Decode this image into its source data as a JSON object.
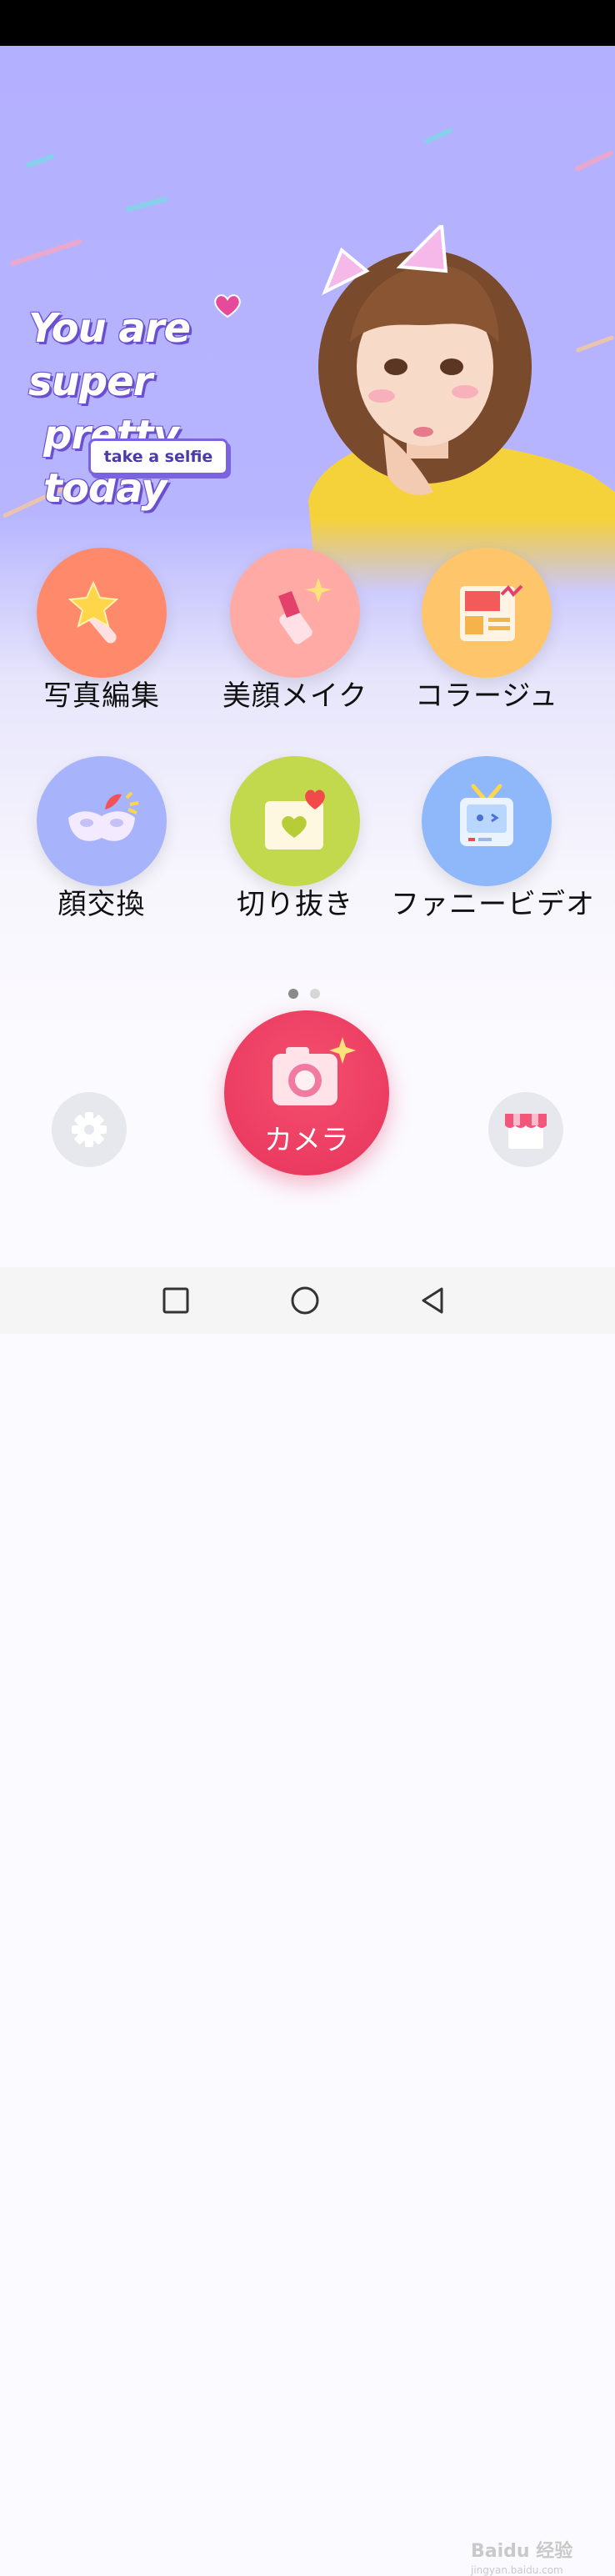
{
  "banner": {
    "tagline_line1": "You are super",
    "tagline_line2": "pretty today",
    "selfie_button": "take a selfie",
    "colors": {
      "background": "#b3b0ff",
      "accent": "#6a4fd0"
    }
  },
  "features": [
    {
      "label": "写真編集",
      "icon": "magic-wand-icon",
      "color": "#ff8a6b"
    },
    {
      "label": "美顔メイク",
      "icon": "lipstick-icon",
      "color": "#ffaaa4"
    },
    {
      "label": "コラージュ",
      "icon": "collage-icon",
      "color": "#ffc56a"
    },
    {
      "label": "顔交換",
      "icon": "mask-icon",
      "color": "#a7b3fb"
    },
    {
      "label": "切り抜き",
      "icon": "heart-card-icon",
      "color": "#c2d94d"
    },
    {
      "label": "ファニービデオ",
      "icon": "tv-icon",
      "color": "#8fb8fb"
    }
  ],
  "pagination": {
    "current": 1,
    "total": 2
  },
  "camera": {
    "label": "カメラ",
    "color": "#ee3f64"
  },
  "actions": {
    "settings_icon": "gear-icon",
    "shop_icon": "store-icon"
  },
  "watermark": {
    "brand": "Baidu 经验",
    "url": "jingyan.baidu.com"
  }
}
